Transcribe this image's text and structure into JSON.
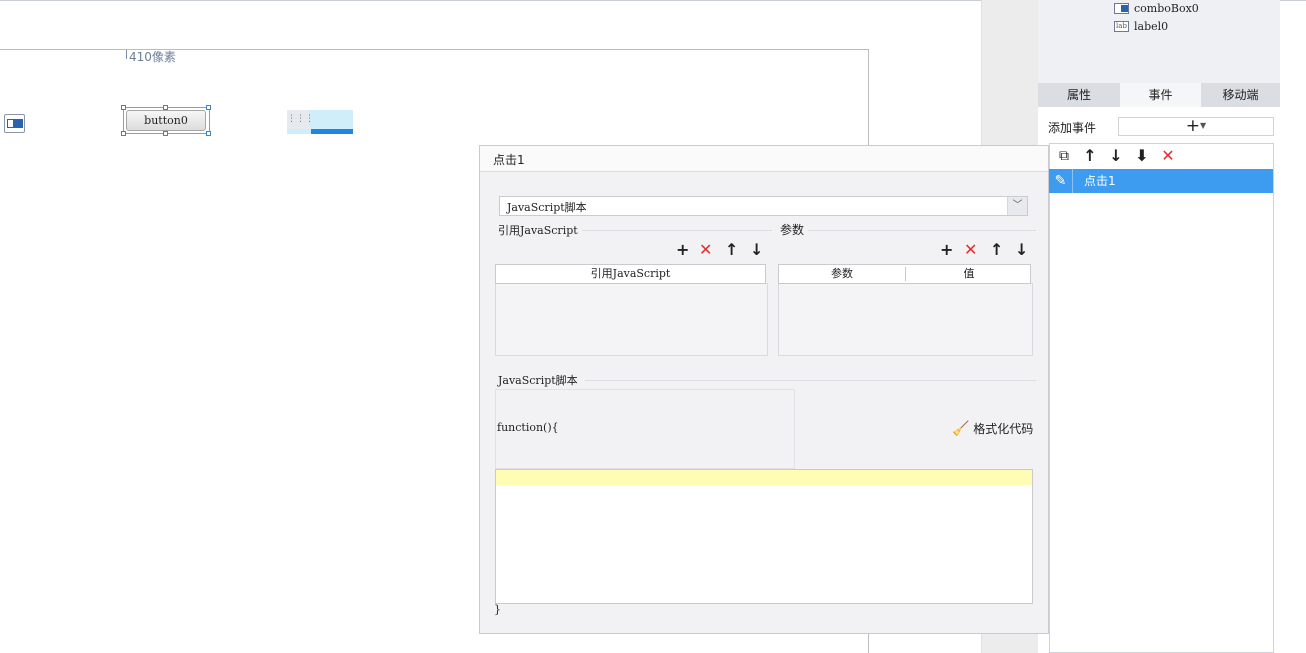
{
  "canvas": {
    "ruler_label": "410像素",
    "button_label": "button0"
  },
  "component_tree": {
    "items": [
      {
        "label": "comboBox0",
        "icon": "combobox-icon"
      },
      {
        "label": "label0",
        "icon": "label-icon",
        "icon_text": "lab"
      }
    ]
  },
  "panel": {
    "tabs": [
      {
        "label": "属性"
      },
      {
        "label": "事件"
      },
      {
        "label": "移动端"
      }
    ],
    "active_tab": "事件",
    "add_event_label": "添加事件",
    "add_event_button": "+",
    "events": [
      {
        "label": "点击1",
        "selected": true
      }
    ]
  },
  "dialog": {
    "title": "点击1",
    "type_value": "JavaScript脚本",
    "ref_js_section": "引用JavaScript",
    "params_section": "参数",
    "ref_js_column": "引用JavaScript",
    "params_columns": [
      "参数",
      "值"
    ],
    "script_section": "JavaScript脚本",
    "function_header": "function(){",
    "format_button": "格式化代码",
    "closing_brace": "}"
  },
  "colors": {
    "selection_blue": "#3d9bf0",
    "delete_red": "#e0302c",
    "editor_highlight": "#fffdb3"
  }
}
